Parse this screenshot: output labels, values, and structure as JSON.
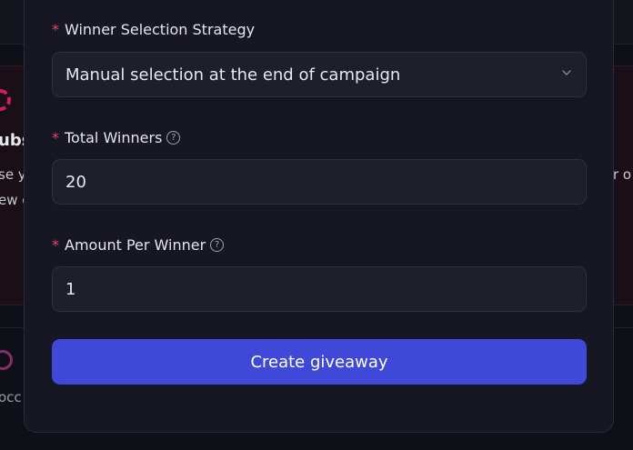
{
  "background": {
    "heading_fragment": "ubs",
    "line1_fragment": "se y",
    "line2_fragment": "ew c",
    "right_fragment": "r o",
    "bottom_fragment": "occ"
  },
  "form": {
    "strategy": {
      "label": "Winner Selection Strategy",
      "required_mark": "*",
      "value": "Manual selection at the end of campaign"
    },
    "total_winners": {
      "label": "Total Winners",
      "required_mark": "*",
      "help_icon": "question-circle-icon",
      "value": "20"
    },
    "amount_per_winner": {
      "label": "Amount Per Winner",
      "required_mark": "*",
      "help_icon": "question-circle-icon",
      "value": "1"
    },
    "submit_label": "Create giveaway"
  },
  "colors": {
    "accent": "#4048d8",
    "required": "#e0486a",
    "modal_bg": "#171723",
    "input_bg": "#1f1f2c"
  }
}
